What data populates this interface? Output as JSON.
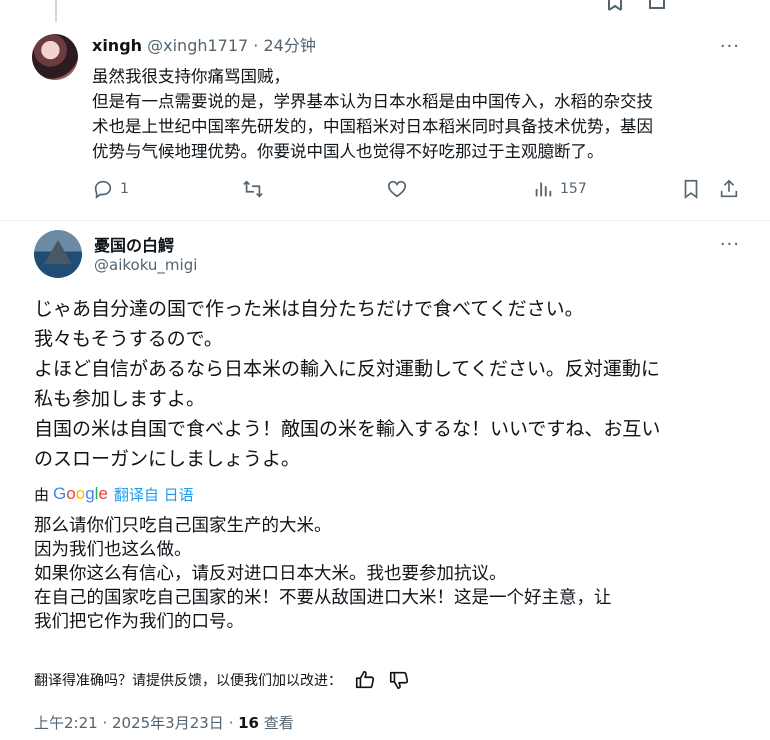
{
  "reply": {
    "display_name": "xingh",
    "handle": "@xingh1717",
    "separator": " · ",
    "time": "24分钟",
    "more": "···",
    "lines": [
      "虽然我很支持你痛骂国贼，",
      "但是有一点需要说的是，学界基本认为日本水稻是由中国传入，水稻的杂交技",
      "术也是上世纪中国率先研发的，中国稻米对日本稻米同时具备技术优势，基因",
      "优势与气候地理优势。你要说中国人也觉得不好吃那过于主观臆断了。"
    ],
    "actions": {
      "reply_count": "1",
      "repost_count": "",
      "like_count": "",
      "view_count": "157"
    }
  },
  "main": {
    "display_name": "憂国の白鰐",
    "handle": "@aikoku_migi",
    "more": "···",
    "original_lines": [
      "じゃあ自分達の国で作った米は自分たちだけで食べてください。",
      "我々もそうするので。",
      "よほど自信があるなら日本米の輸入に反対運動してください。反対運動に",
      "私も参加しますよ。",
      "自国の米は自国で食べよう！敵国の米を輸入するな！いいですね、お互い",
      "のスローガンにしましょうよ。"
    ],
    "translation": {
      "by": "由",
      "google": "Google",
      "from": "翻译自 日语",
      "lines": [
        "那么请你们只吃自己国家生产的大米。",
        "因为我们也这么做。",
        "如果你这么有信心，请反对进口日本大米。我也要参加抗议。",
        "在自己的国家吃自己国家的米！不要从敌国进口大米！这是一个好主意，让",
        "我们把它作为我们的口号。"
      ],
      "feedback": "翻译得准确吗？请提供反馈，以便我们加以改进："
    },
    "time": "上午2:21",
    "separator": " · ",
    "date": "2025年3月23日",
    "views_count": "16",
    "views_label": " 查看"
  },
  "icons": {
    "reply": "comment-icon",
    "repost": "repost-icon",
    "like": "heart-icon",
    "views": "analytics-icon",
    "bookmark": "bookmark-icon",
    "share": "share-icon",
    "thumbs_up": "thumbs-up-icon",
    "thumbs_down": "thumbs-down-icon"
  }
}
